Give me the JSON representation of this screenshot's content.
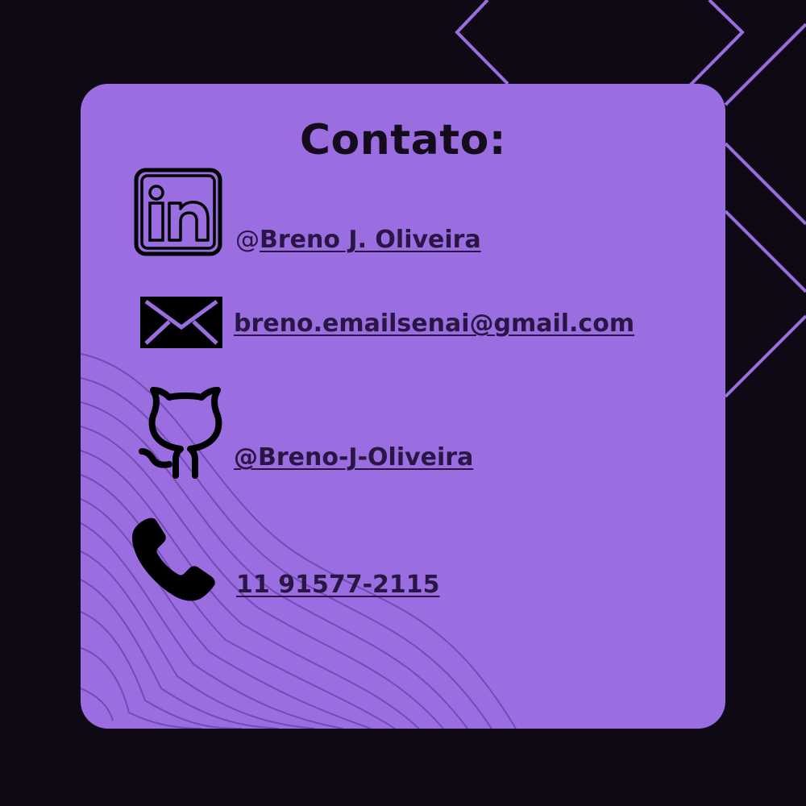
{
  "card": {
    "title": "Contato:"
  },
  "contacts": {
    "linkedin": {
      "icon": "linkedin-icon",
      "prefix": "@",
      "label": "Breno J. Oliveira"
    },
    "email": {
      "icon": "envelope-icon",
      "label": "breno.emailsenai@gmail.com"
    },
    "github": {
      "icon": "github-icon",
      "label": "@Breno-J-Oliveira"
    },
    "phone": {
      "icon": "phone-icon",
      "label": "11 91577-2115"
    }
  },
  "colors": {
    "background": "#0f0916",
    "card": "#9a6ee0",
    "accent_lines": "#9a6ee0",
    "text": "#140b1c",
    "link": "#2a1644"
  }
}
